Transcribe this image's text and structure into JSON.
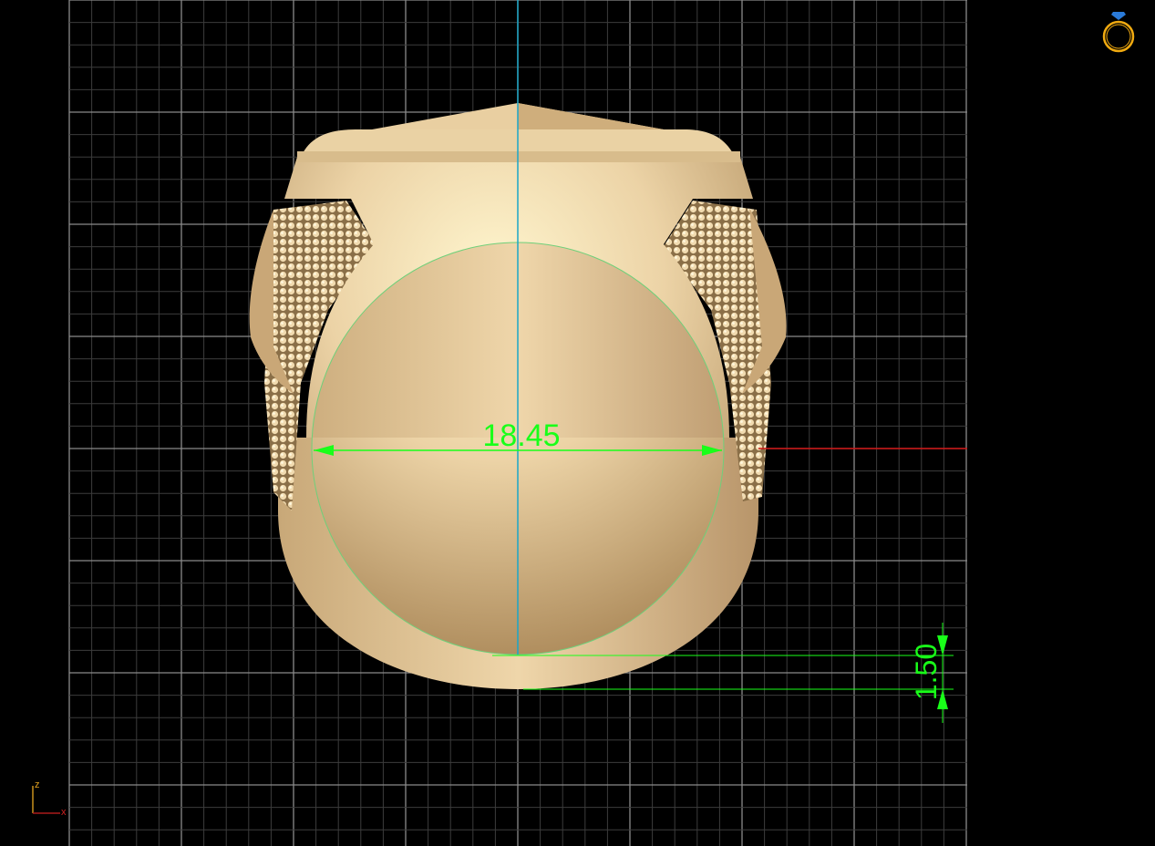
{
  "viewport": {
    "dimensions": {
      "inner_diameter": "18.45",
      "shank_thickness": "1.50"
    },
    "axis_triad": {
      "z_label": "z",
      "x_label": "x"
    },
    "icons": {
      "corner_icon": "ring-icon"
    },
    "colors": {
      "background": "#000000",
      "grid_major": "#8a8a8a",
      "grid_minor": "#3c3c3c",
      "vertical_axis": "#1aa6c8",
      "horizontal_axis": "#cc1111",
      "dimension": "#19ff19",
      "metal": "#e8c898"
    }
  }
}
